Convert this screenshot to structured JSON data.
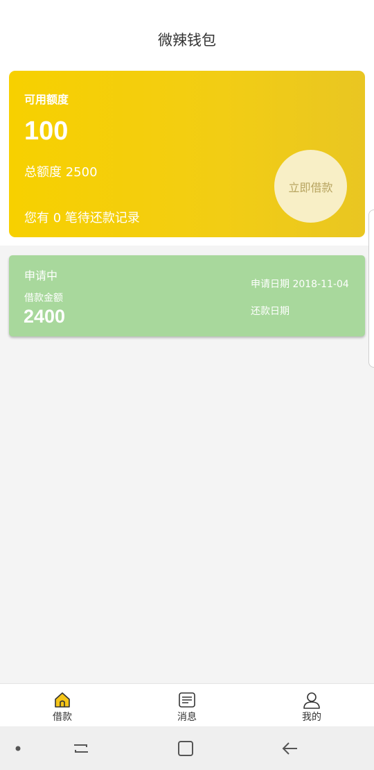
{
  "header": {
    "title": "微辣钱包"
  },
  "credit_card": {
    "available_label": "可用额度",
    "available_value": "100",
    "total_label": "总额度",
    "total_value": "2500",
    "pending_prefix": "您有",
    "pending_count": "0",
    "pending_suffix": "笔待还款记录",
    "borrow_button_label": "立即借款",
    "color": "#f5cf0a"
  },
  "loan": {
    "status": "申请中",
    "amount_label": "借款金额",
    "amount": "2400",
    "apply_date_label": "申请日期",
    "apply_date": "2018-11-04",
    "repay_date_label": "还款日期",
    "color": "#a8d89c"
  },
  "tabbar": {
    "tabs": [
      {
        "label": "借款",
        "icon": "home-icon",
        "active": true
      },
      {
        "label": "消息",
        "icon": "message-icon",
        "active": false
      },
      {
        "label": "我的",
        "icon": "user-icon",
        "active": false
      }
    ]
  },
  "system_nav": {
    "buttons": [
      "dot-icon",
      "recent-apps-icon",
      "home-button-icon",
      "back-icon"
    ]
  }
}
